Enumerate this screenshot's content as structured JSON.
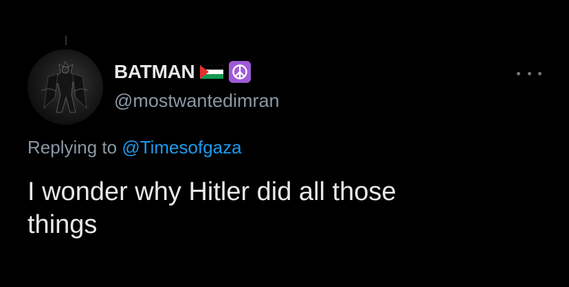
{
  "tweet": {
    "display_name": "BATMAN",
    "handle": "@mostwantedimran",
    "flag_icon": "palestine-flag-icon",
    "badge_icon": "peace-symbol-icon",
    "reply_prefix": "Replying to",
    "reply_mention": "@Timesofgaza",
    "text_line1": "I wonder why Hitler did all those",
    "text_line2": "things",
    "more_icon": "more-options-icon"
  },
  "colors": {
    "background": "#000000",
    "primary_text": "#e7e9ea",
    "secondary_text": "#8b98a5",
    "link": "#1d9bf0",
    "peace_badge": "#a05ad8"
  }
}
